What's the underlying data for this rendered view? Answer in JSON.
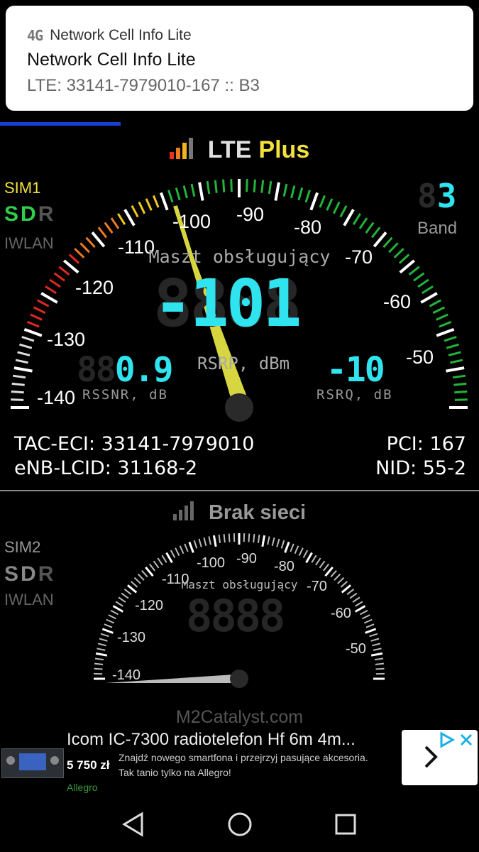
{
  "notification": {
    "app_icon_text": "4G",
    "app_name": "Network Cell Info Lite",
    "title": "Network Cell Info Lite",
    "text": "LTE: 33141-7979010-167 :: B3"
  },
  "sim1": {
    "tech_label": "LTE",
    "tech_suffix": "Plus",
    "sim_label": "SIM1",
    "sdr": {
      "s": "S",
      "d": "D",
      "r": "R"
    },
    "iwlan": "IWLAN",
    "band_value": "3",
    "band_label": "Band",
    "gauge_title": "Maszt obsługujący",
    "rsrp_value": "-101",
    "rsrp_label": "RSRP, dBm",
    "rssnr_value": "0.9",
    "rssnr_label": "RSSNR, dB",
    "rsrq_value": "-10",
    "rsrq_label": "RSRQ, dB",
    "scale": [
      "-140",
      "-130",
      "-120",
      "-110",
      "-100",
      "-90",
      "-80",
      "-70",
      "-60",
      "-50"
    ],
    "tac_eci_label": "TAC-ECI:",
    "tac_eci": "33141-7979010",
    "enb_lcid_label": "eNB-LCID:",
    "enb_lcid": "31168-2",
    "pci_label": "PCI:",
    "pci": "167",
    "nid_label": "NID:",
    "nid": "55-2"
  },
  "sim2": {
    "status": "Brak sieci",
    "sim_label": "SIM2",
    "sdr": {
      "s": "S",
      "d": "D",
      "r": "R"
    },
    "iwlan": "IWLAN",
    "gauge_title": "Maszt obsługujący",
    "scale": [
      "-140",
      "-130",
      "-120",
      "-110",
      "-100",
      "-90",
      "-80",
      "-70",
      "-60",
      "-50"
    ]
  },
  "footer": {
    "brand": "M2Catalyst.com"
  },
  "ad": {
    "title": "Icom IC-7300 radiotelefon Hf 6m 4m...",
    "price": "5 750 zł",
    "line1": "Znajdź nowego smartfona i przejrzyj pasujące akcesoria.",
    "line2": "Tak tanio tylko na Allegro!",
    "advertiser": "Allegro"
  },
  "colors": {
    "accent_yellow": "#f0e23a",
    "seg_cyan": "#2fe3ef",
    "progress_blue": "#1a3fd6"
  }
}
